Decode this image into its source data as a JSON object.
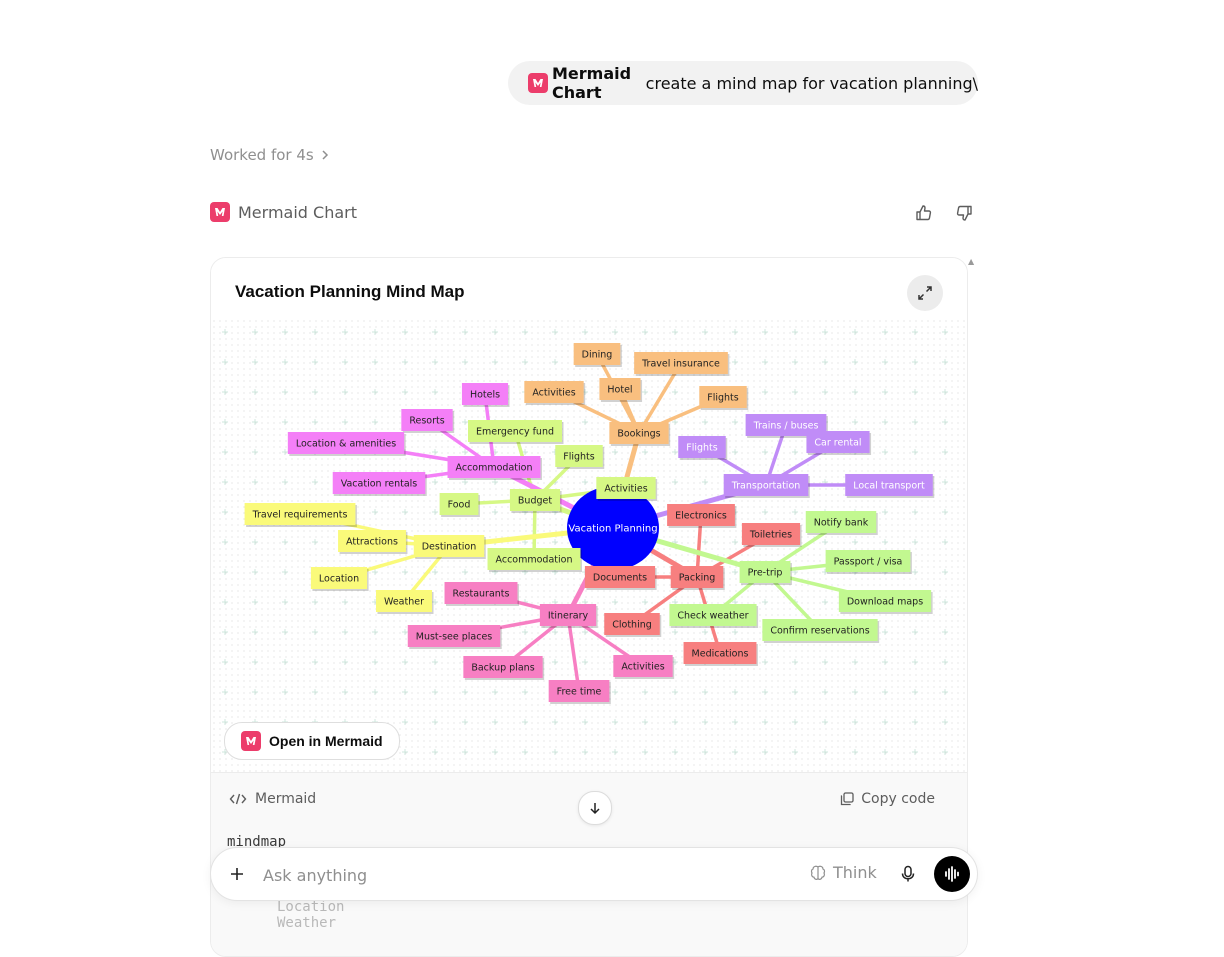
{
  "user_message": {
    "app_name": "Mermaid Chart",
    "prompt": "create a mind map for vacation planning\\"
  },
  "worked_for": "Worked for 4s",
  "assistant": {
    "app_name": "Mermaid Chart"
  },
  "card": {
    "title": "Vacation Planning Mind Map",
    "open_button": "Open in Mermaid",
    "code_lang": "Mermaid",
    "copy_label": "Copy code",
    "code_first_line": "mindmap",
    "code_ghost_lines": "Location\nWeather"
  },
  "mindmap": {
    "root": "Vacation Planning",
    "root_color": "#0000ff",
    "branches": [
      {
        "name": "Bookings",
        "color": "#f9bf7f",
        "children": [
          "Dining",
          "Travel insurance",
          "Activities",
          "Hotel",
          "Flights"
        ]
      },
      {
        "name": "Transportation",
        "color": "#c08cf7",
        "children": [
          "Flights",
          "Trains / buses",
          "Car rental",
          "Local transport"
        ]
      },
      {
        "name": "Budget",
        "color": "#d6f885",
        "children": [
          "Emergency fund",
          "Flights",
          "Food",
          "Activities",
          "Accommodation"
        ]
      },
      {
        "name": "Accommodation",
        "color": "#f47ff7",
        "children": [
          "Hotels",
          "Resorts",
          "Location & amenities",
          "Vacation rentals"
        ]
      },
      {
        "name": "Destination",
        "color": "#fafa7a",
        "children": [
          "Travel requirements",
          "Attractions",
          "Location",
          "Weather"
        ]
      },
      {
        "name": "Itinerary",
        "color": "#f77fc3",
        "children": [
          "Restaurants",
          "Must-see places",
          "Backup plans",
          "Free time",
          "Activities"
        ]
      },
      {
        "name": "Packing",
        "color": "#f77f7f",
        "children": [
          "Electronics",
          "Toiletries",
          "Documents",
          "Clothing",
          "Medications"
        ]
      },
      {
        "name": "Pre-trip",
        "color": "#c2f890",
        "children": [
          "Notify bank",
          "Passport / visa",
          "Download maps",
          "Confirm reservations",
          "Check weather"
        ]
      }
    ]
  },
  "composer": {
    "placeholder": "Ask anything",
    "think_label": "Think"
  },
  "icons": {
    "logo": "mermaid-logo-icon",
    "chevron": "chevron-right-icon",
    "thumbs_up": "thumbs-up-icon",
    "thumbs_down": "thumbs-down-icon",
    "expand": "expand-icon",
    "code": "code-icon",
    "copy": "copy-icon",
    "arrow_down": "arrow-down-icon",
    "plus": "plus-icon",
    "think": "brain-icon",
    "mic": "microphone-icon",
    "voice": "voice-waveform-icon"
  }
}
